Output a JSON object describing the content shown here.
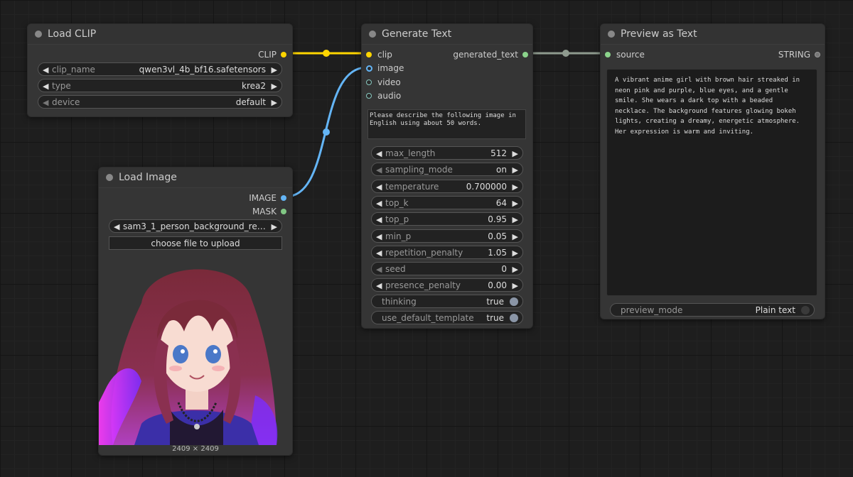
{
  "nodes": {
    "load_clip": {
      "title": "Load CLIP",
      "output_clip": "CLIP",
      "clip_name_label": "clip_name",
      "clip_name_value": "qwen3vl_4b_bf16.safetensors",
      "type_label": "type",
      "type_value": "krea2",
      "device_label": "device",
      "device_value": "default"
    },
    "load_image": {
      "title": "Load Image",
      "output_image": "IMAGE",
      "output_mask": "MASK",
      "image_value": "sam3_1_person_background_rem…",
      "upload_label": "choose file to upload",
      "image_size": "2409 × 2409"
    },
    "generate_text": {
      "title": "Generate Text",
      "input_clip": "clip",
      "input_image": "image",
      "input_video": "video",
      "input_audio": "audio",
      "output_text": "generated_text",
      "prompt": "Please describe the following image in English using about 50 words.",
      "params": [
        {
          "label": "max_length",
          "value": "512",
          "left_dim": false
        },
        {
          "label": "sampling_mode",
          "value": "on",
          "left_dim": true
        },
        {
          "label": "temperature",
          "value": "0.700000",
          "left_dim": false
        },
        {
          "label": "top_k",
          "value": "64",
          "left_dim": false
        },
        {
          "label": "top_p",
          "value": "0.95",
          "left_dim": false
        },
        {
          "label": "min_p",
          "value": "0.05",
          "left_dim": false
        },
        {
          "label": "repetition_penalty",
          "value": "1.05",
          "left_dim": false
        },
        {
          "label": "seed",
          "value": "0",
          "left_dim": true
        },
        {
          "label": "presence_penalty",
          "value": "0.00",
          "left_dim": false
        }
      ],
      "thinking_label": "thinking",
      "thinking_value": "true",
      "template_label": "use_default_template",
      "template_value": "true"
    },
    "preview_text": {
      "title": "Preview as Text",
      "input_source": "source",
      "output_string": "STRING",
      "text": "A vibrant anime girl with brown hair streaked in neon pink and purple, blue eyes, and a gentle smile. She wears a dark top with a beaded necklace. The background features glowing bokeh lights, creating a dreamy, energetic atmosphere. Her expression is warm and inviting.",
      "mode_label": "preview_mode",
      "mode_value": "Plain text"
    }
  },
  "colors": {
    "clip_link": "#ffd500",
    "image_link": "#64b5f6",
    "string_link": "#8e9a8e"
  },
  "icons": {
    "left_arrow": "◀",
    "right_arrow": "▶"
  }
}
